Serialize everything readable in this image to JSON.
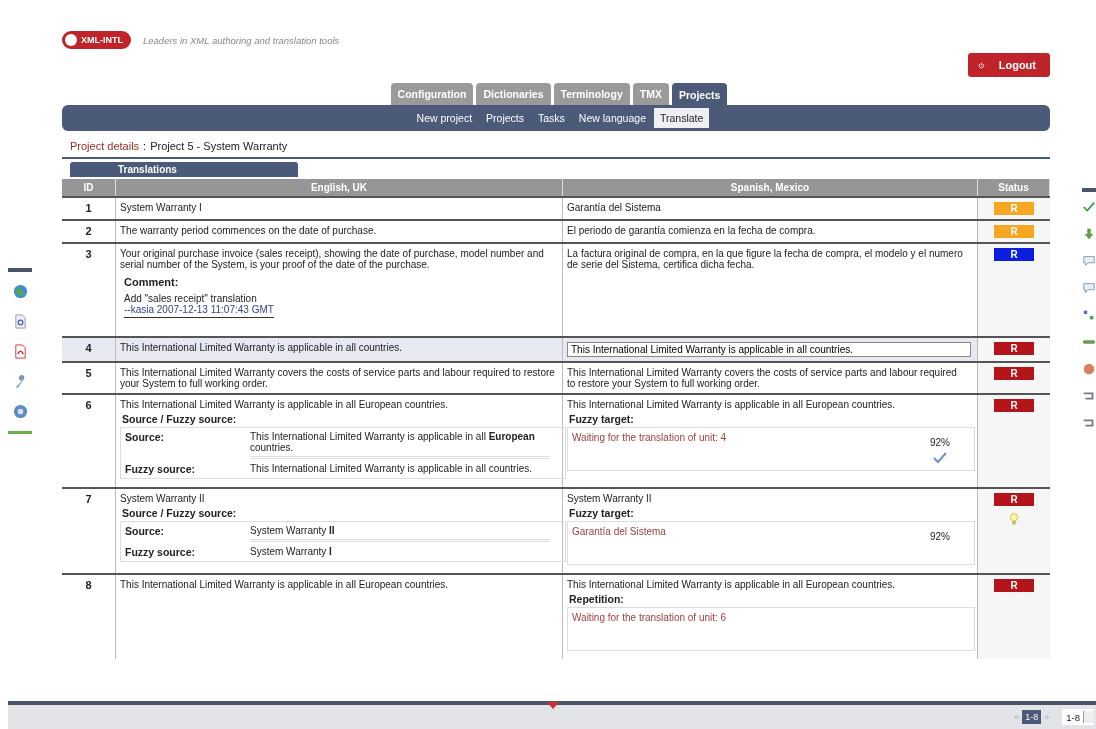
{
  "header": {
    "logo": "XML-INTL",
    "tagline": "Leaders in XML authoring and translation tools",
    "logout": "Logout"
  },
  "tabs": [
    {
      "label": "Configuration",
      "selected": false
    },
    {
      "label": "Dictionaries",
      "selected": false
    },
    {
      "label": "Terminology",
      "selected": false
    },
    {
      "label": "TMX",
      "selected": false
    },
    {
      "label": "Projects",
      "selected": true
    }
  ],
  "subnav": [
    {
      "label": "New project",
      "selected": false
    },
    {
      "label": "Projects",
      "selected": false
    },
    {
      "label": "Tasks",
      "selected": false
    },
    {
      "label": "New language",
      "selected": false
    },
    {
      "label": "Translate",
      "selected": true
    }
  ],
  "breadcrumb": {
    "label": "Project details",
    "separator": ":",
    "value": "Project 5 - System Warranty"
  },
  "panel_tab": "Translations",
  "table": {
    "columns": [
      "ID",
      "English, UK",
      "Spanish, Mexico",
      "Status"
    ],
    "rows": [
      {
        "id": "1",
        "selected": false,
        "source": "System Warranty I",
        "target": "Garantía del Sistema",
        "status": {
          "label": "R",
          "color": "#f5a623"
        }
      },
      {
        "id": "2",
        "selected": false,
        "source": "The warranty period commences on the date of purchase.",
        "target": "El periodo de garantía comienza en la fecha de compra.",
        "status": {
          "label": "R",
          "color": "#f5a623"
        }
      },
      {
        "id": "3",
        "selected": false,
        "source": "Your original purchase invoice (sales receipt), showing the date of purchase, model number and serial number of the System, is your proof of the date of the purchase.",
        "target": "La factura original de compra, en la que figure la fecha de compra, el modelo y el numero de serie del Sistema, certifica dicha fecha.",
        "status": {
          "label": "R",
          "color": "#0a1ee0"
        },
        "comment": {
          "title": "Comment:",
          "text": "Add \"sales receipt\" translation",
          "author": "--kasia 2007-12-13 11:07:43 GMT"
        }
      },
      {
        "id": "4",
        "selected": true,
        "source": "This International Limited Warranty is applicable in all countries.",
        "target": "This International Limited Warranty is applicable in all countries.",
        "status": {
          "label": "R",
          "color": "#b3151b"
        }
      },
      {
        "id": "5",
        "selected": false,
        "source": "This International Limited Warranty covers the costs of service parts and labour required to restore your System to full working order.",
        "target": "This International Limited Warranty covers the costs of service parts and labour required to restore your System to full working order.",
        "status": {
          "label": "R",
          "color": "#b3151b"
        }
      },
      {
        "id": "6",
        "selected": false,
        "source": "This International Limited Warranty is applicable in all European countries.",
        "target": "This International Limited Warranty is applicable in all European countries.",
        "status": {
          "label": "R",
          "color": "#b3151b"
        },
        "fuzzy": {
          "title": "Source / Fuzzy source:",
          "source_label": "Source:",
          "source": "This International Limited Warranty is applicable in all **European** countries.",
          "fuzzy_label": "Fuzzy source:",
          "fuzzy_source": "This International Limited Warranty is applicable in all countries."
        },
        "target_box": {
          "title": "Fuzzy target:",
          "text": "Waiting for the translation of unit: 4",
          "match": "92%",
          "approved": true
        }
      },
      {
        "id": "7",
        "selected": false,
        "source": "System Warranty II",
        "target": "System Warranty II",
        "status": {
          "label": "R",
          "color": "#b3151b"
        },
        "hint": true,
        "fuzzy": {
          "title": "Source / Fuzzy source:",
          "source_label": "Source:",
          "source": "System Warranty **II**",
          "fuzzy_label": "Fuzzy source:",
          "fuzzy_source": "System Warranty **I**"
        },
        "target_box": {
          "title": "Fuzzy target:",
          "text": "Garantía del Sistema",
          "match": "92%",
          "approved": false
        }
      },
      {
        "id": "8",
        "selected": false,
        "source": "This International Limited Warranty is applicable in all European countries.",
        "target": "This International Limited Warranty is applicable in all European countries.",
        "status": {
          "label": "R",
          "color": "#b3151b"
        },
        "target_box": {
          "title": "Repetition:",
          "text": "Waiting for the translation of unit: 6"
        }
      }
    ]
  },
  "pagination": {
    "prev": "«",
    "page": "1-8",
    "next": "»",
    "range": "1-8"
  }
}
